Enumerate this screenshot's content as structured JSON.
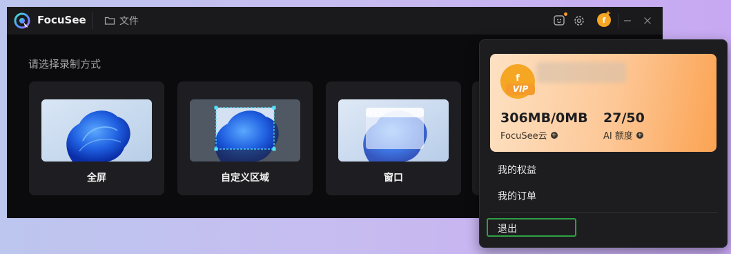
{
  "app": {
    "name": "FocuSee",
    "files_label": "文件",
    "section_label": "请选择录制方式",
    "modes": [
      {
        "label": "全屏"
      },
      {
        "label": "自定义区域"
      },
      {
        "label": "窗口"
      }
    ],
    "avatar_letter": "f",
    "accent_color": "#f5a623"
  },
  "account_panel": {
    "avatar_letter": "f",
    "vip_badge": "VIP",
    "storage_value": "306MB/0MB",
    "storage_label": "FocuSee云",
    "ai_value": "27/50",
    "ai_label": "AI 额度",
    "menu": {
      "benefits": "我的权益",
      "orders": "我的订单",
      "logout": "退出"
    },
    "highlight_color": "#2ea043"
  }
}
